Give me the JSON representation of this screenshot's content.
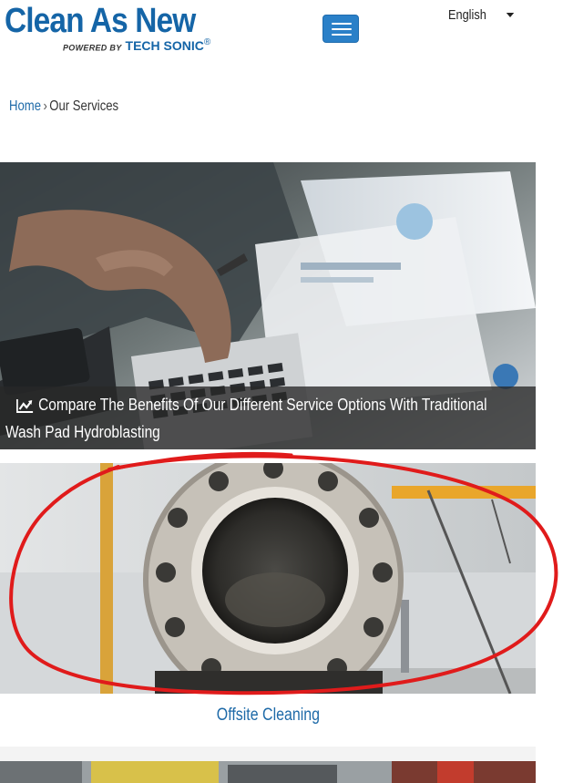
{
  "header": {
    "logo_main": "Clean As New",
    "logo_powered_by": "POWERED BY",
    "logo_brand": "TECH SONIC",
    "logo_reg": "®",
    "menu_icon": "hamburger-menu-icon",
    "language": "English",
    "language_icon": "caret-down-icon"
  },
  "breadcrumb": {
    "home": "Home",
    "separator": "›",
    "current": "Our Services"
  },
  "cards": [
    {
      "icon": "chart-line-icon",
      "title": "Compare The Benefits Of Our Different Service Options With Traditional Wash Pad Hydroblasting"
    },
    {
      "title": "Offsite Cleaning"
    }
  ],
  "colors": {
    "brand_blue": "#1565a7",
    "link_blue": "#1e6aa8",
    "menu_button": "#2a80c8",
    "annotation_red": "#e01b1b"
  }
}
